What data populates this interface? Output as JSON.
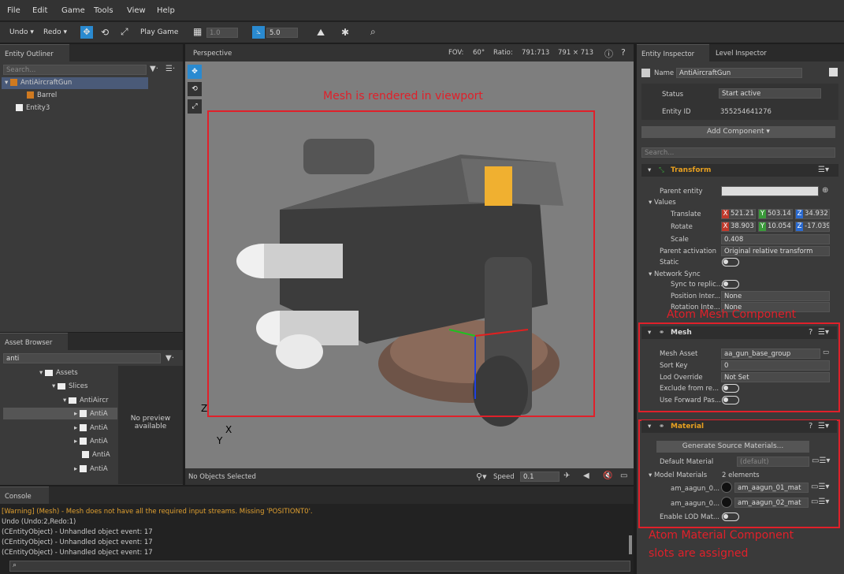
{
  "menu": {
    "file": "File",
    "edit": "Edit",
    "game": "Game",
    "tools": "Tools",
    "view": "View",
    "help": "Help"
  },
  "toolbar": {
    "undo": "Undo",
    "redo": "Redo",
    "play_game": "Play Game",
    "grid_value": "1.0",
    "snap_value": "5.0"
  },
  "outliner": {
    "tab": "Entity Outliner",
    "search_placeholder": "Search...",
    "items": [
      {
        "label": "AntiAircraftGun"
      },
      {
        "label": "Barrel"
      },
      {
        "label": "Entity3"
      }
    ]
  },
  "viewport": {
    "tab": "Perspective",
    "fov_label": "FOV:",
    "fov_value": "60°",
    "ratio_label": "Ratio:",
    "ratio_value": "791:713",
    "size_value": "791 × 713",
    "status": "No Objects Selected",
    "speed_label": "Speed",
    "speed_value": "0.1",
    "annotation": "Mesh is rendered in viewport",
    "axis_z": "Z",
    "axis_x": "X",
    "axis_y": "Y"
  },
  "asset_browser": {
    "tab": "Asset Browser",
    "search_value": "anti",
    "tree": [
      {
        "label": "Assets"
      },
      {
        "label": "Slices"
      },
      {
        "label": "AntiAircr"
      },
      {
        "label": "AntiA"
      },
      {
        "label": "AntiA"
      },
      {
        "label": "AntiA"
      },
      {
        "label": "AntiA"
      },
      {
        "label": "AntiA"
      }
    ],
    "preview_line1": "No preview",
    "preview_line2": "available"
  },
  "console": {
    "tab": "Console",
    "lines": [
      "[Warning] (Mesh) - Mesh does not have all the required input streams. Missing 'POSITIONT0'.",
      "Undo (Undo:2,Redo:1)",
      "(CEntityObject) - Unhandled object event: 17",
      "(CEntityObject) - Unhandled object event: 17",
      "(CEntityObject) - Unhandled object event: 17"
    ]
  },
  "inspector": {
    "tab1": "Entity Inspector",
    "tab2": "Level Inspector",
    "name_label": "Name",
    "name_value": "AntiAircraftGun",
    "status_label": "Status",
    "status_value": "Start active",
    "id_label": "Entity ID",
    "id_value": "355254641276",
    "add_component": "Add Component ▾",
    "search_placeholder": "Search...",
    "transform": {
      "title": "Transform",
      "parent_entity": "Parent entity",
      "values": "Values",
      "translate": "Translate",
      "tx": "521.21",
      "ty": "503.14",
      "tz": "34.932",
      "rotate": "Rotate",
      "rx": "38.903",
      "ry": "10.054",
      "rz": "-17.039",
      "scale": "Scale",
      "scale_value": "0.408",
      "parent_activation": "Parent activation",
      "parent_activation_value": "Original relative transform",
      "static": "Static",
      "network_sync": "Network Sync",
      "sync_replicas": "Sync to replic...",
      "position_interp": "Position Inter...",
      "position_interp_value": "None",
      "rotation_interp": "Rotation Inte...",
      "rotation_interp_value": "None"
    },
    "mesh": {
      "title": "Mesh",
      "annotation": "Atom Mesh Component",
      "mesh_asset": "Mesh Asset",
      "mesh_asset_value": "aa_gun_base_group",
      "sort_key": "Sort Key",
      "sort_key_value": "0",
      "lod_override": "Lod Override",
      "lod_override_value": "Not Set",
      "exclude": "Exclude from re...",
      "forward": "Use Forward Pas..."
    },
    "material": {
      "title": "Material",
      "generate": "Generate Source Materials...",
      "default_material": "Default Material",
      "default_value": "(default)",
      "model_materials": "Model Materials",
      "model_count": "2 elements",
      "slot1_label": "am_aagun_0...",
      "slot1_value": "am_aagun_01_mat",
      "slot2_label": "am_aagun_0...",
      "slot2_value": "am_aagun_02_mat",
      "enable_lod": "Enable LOD Mat...",
      "annotation1": "Atom Material Component",
      "annotation2": "slots are  assigned"
    }
  },
  "colors": {
    "accent": "#e0202a",
    "transform_title": "#e8a020",
    "x": "#c0392b",
    "y": "#3a9a3a",
    "z": "#2a6ad0"
  }
}
